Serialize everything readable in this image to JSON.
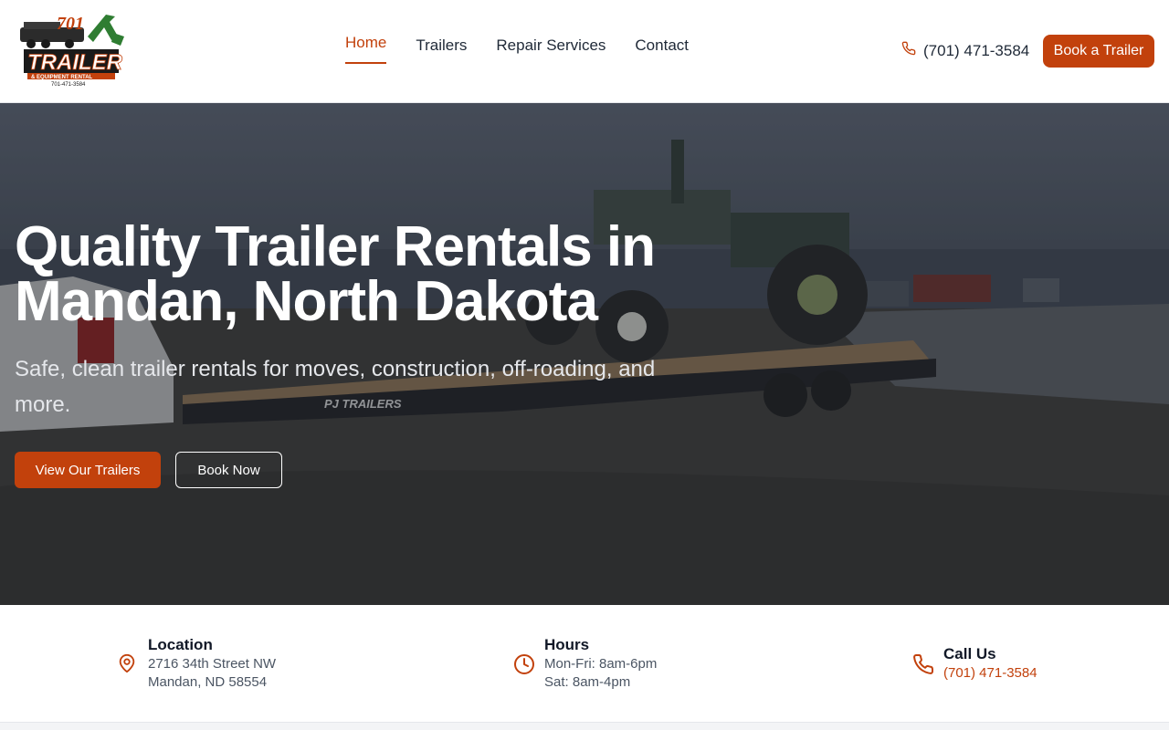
{
  "brand": {
    "logo_text": "701 TRAILER",
    "logo_sub": "& EQUIPMENT RENTAL",
    "logo_phone": "701-471-3584"
  },
  "nav": {
    "items": [
      {
        "label": "Home",
        "active": true
      },
      {
        "label": "Trailers",
        "active": false
      },
      {
        "label": "Repair Services",
        "active": false
      },
      {
        "label": "Contact",
        "active": false
      }
    ]
  },
  "header": {
    "phone": "(701) 471-3584",
    "phone_icon": "phone-icon",
    "book_label": "Book a Trailer"
  },
  "hero": {
    "title": "Quality Trailer Rentals in Mandan, North Dakota",
    "subtitle": "Safe, clean trailer rentals for moves, construction, off-roading, and more.",
    "primary_cta": "View Our Trailers",
    "secondary_cta": "Book Now",
    "trailer_brand": "PJ TRAILERS"
  },
  "info": {
    "location": {
      "title": "Location",
      "line1": "2716 34th Street NW",
      "line2": "Mandan, ND 58554",
      "icon": "map-pin-icon"
    },
    "hours": {
      "title": "Hours",
      "line1": "Mon-Fri: 8am-6pm",
      "line2": "Sat: 8am-4pm",
      "icon": "clock-icon"
    },
    "call": {
      "title": "Call Us",
      "phone": "(701) 471-3584",
      "icon": "phone-icon"
    }
  },
  "colors": {
    "accent": "#c2410c",
    "text": "#1f2937",
    "muted": "#4b5563"
  }
}
